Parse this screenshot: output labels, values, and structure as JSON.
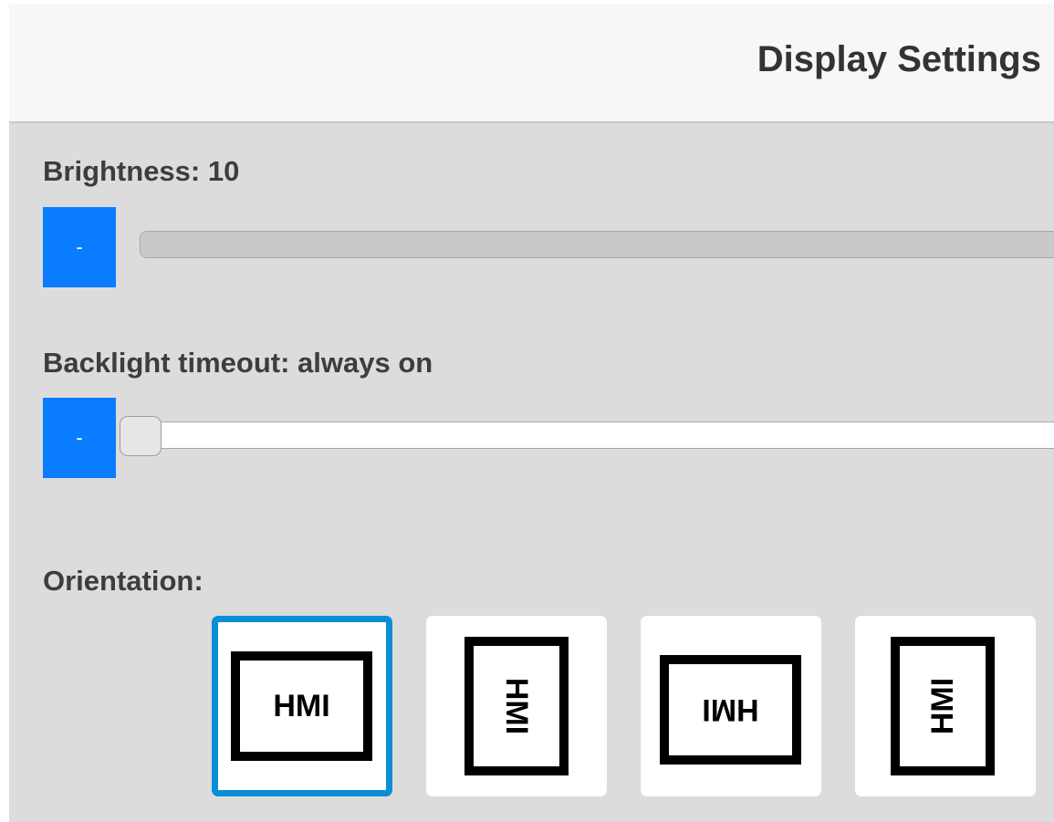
{
  "header": {
    "title": "Display Settings"
  },
  "brightness": {
    "label": "Brightness: 10",
    "decrease_label": "-",
    "level": 1.0
  },
  "backlight": {
    "label": "Backlight timeout: always on",
    "decrease_label": "-",
    "level": 0.0
  },
  "orientation": {
    "label": "Orientation:",
    "options": [
      {
        "text": "HMI",
        "rotation": "0°",
        "selected": true
      },
      {
        "text": "HMI",
        "rotation": "90°",
        "selected": false
      },
      {
        "text": "HMI",
        "rotation": "180°",
        "selected": false
      },
      {
        "text": "HMI",
        "rotation": "270°",
        "selected": false
      }
    ]
  },
  "colors": {
    "accent": "#0a7cff",
    "selected_border": "#0a8fd6",
    "panel_bg": "#dcdcdc",
    "header_bg": "#f7f7f7"
  }
}
